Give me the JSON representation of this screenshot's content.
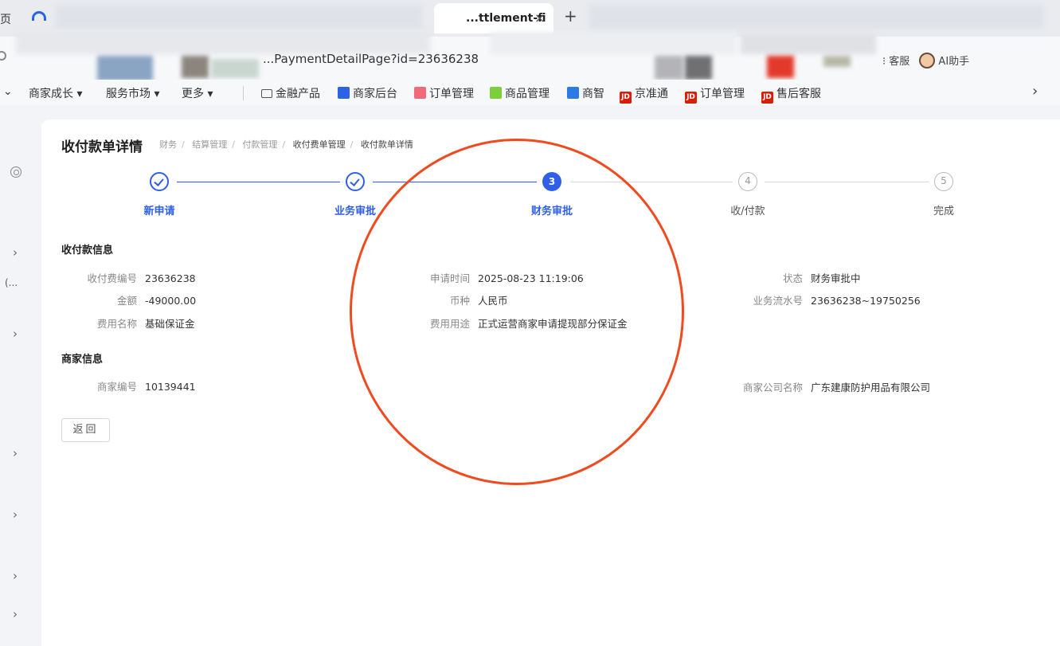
{
  "browser": {
    "left_char": "页",
    "tab_title": "...ttlement-fi",
    "tab_close": "×",
    "new_tab": "+",
    "url": "...PaymentDetailPage?id=23636238",
    "tools": {
      "service": "客服",
      "ai": "AI助手"
    }
  },
  "bookmarks": [
    {
      "label": "商家成长 ▾",
      "icon": "none"
    },
    {
      "label": "服务市场 ▾",
      "icon": "none"
    },
    {
      "label": "更多 ▾",
      "icon": "none"
    },
    {
      "label": "金融产品",
      "icon": "folder-icon",
      "color": "#555555"
    },
    {
      "label": "商家后台",
      "icon": "store-icon",
      "color": "#2b62e6"
    },
    {
      "label": "订单管理",
      "icon": "order-icon",
      "color": "#f06a7a"
    },
    {
      "label": "商品管理",
      "icon": "goods-icon",
      "color": "#7ccf3a"
    },
    {
      "label": "商智",
      "icon": "chart-icon",
      "color": "#2b7ae6"
    },
    {
      "label": "京准通",
      "icon": "jd-icon",
      "color": "#d81e06",
      "badge": "JD"
    },
    {
      "label": "订单管理",
      "icon": "jd-icon",
      "color": "#d81e06",
      "badge": "JD"
    },
    {
      "label": "售后客服",
      "icon": "jd-icon",
      "color": "#d81e06",
      "badge": "JD"
    }
  ],
  "sidebar": {
    "partial_text": "(..."
  },
  "page": {
    "title": "收付款单详情",
    "breadcrumb": [
      "财务",
      "结算管理",
      "付款管理",
      "收付费单管理",
      "收付款单详情"
    ]
  },
  "steps": [
    {
      "label": "新申请",
      "state": "done",
      "num": ""
    },
    {
      "label": "业务审批",
      "state": "done",
      "num": ""
    },
    {
      "label": "财务审批",
      "state": "current",
      "num": "3"
    },
    {
      "label": "收/付款",
      "state": "todo",
      "num": "4"
    },
    {
      "label": "完成",
      "state": "todo",
      "num": "5"
    }
  ],
  "payment_info": {
    "title": "收付款信息",
    "fee_no_label": "收付费编号",
    "fee_no": "23636238",
    "amount_label": "金额",
    "amount": "-49000.00",
    "fee_name_label": "费用名称",
    "fee_name": "基础保证金",
    "apply_time_label": "申请时间",
    "apply_time": "2025-08-23 11:19:06",
    "currency_label": "币种",
    "currency": "人民币",
    "fee_usage_label": "费用用途",
    "fee_usage": "正式运营商家申请提现部分保证金",
    "status_label": "状态",
    "status": "财务审批中",
    "serial_label": "业务流水号",
    "serial": "23636238~19750256"
  },
  "merchant_info": {
    "title": "商家信息",
    "merchant_no_label": "商家编号",
    "merchant_no": "10139441",
    "company_label": "商家公司名称",
    "company": "广东建康防护用品有限公司"
  },
  "actions": {
    "back": "返回"
  },
  "colors": {
    "primary": "#2e5fe6",
    "annotation": "#f04a1f"
  }
}
